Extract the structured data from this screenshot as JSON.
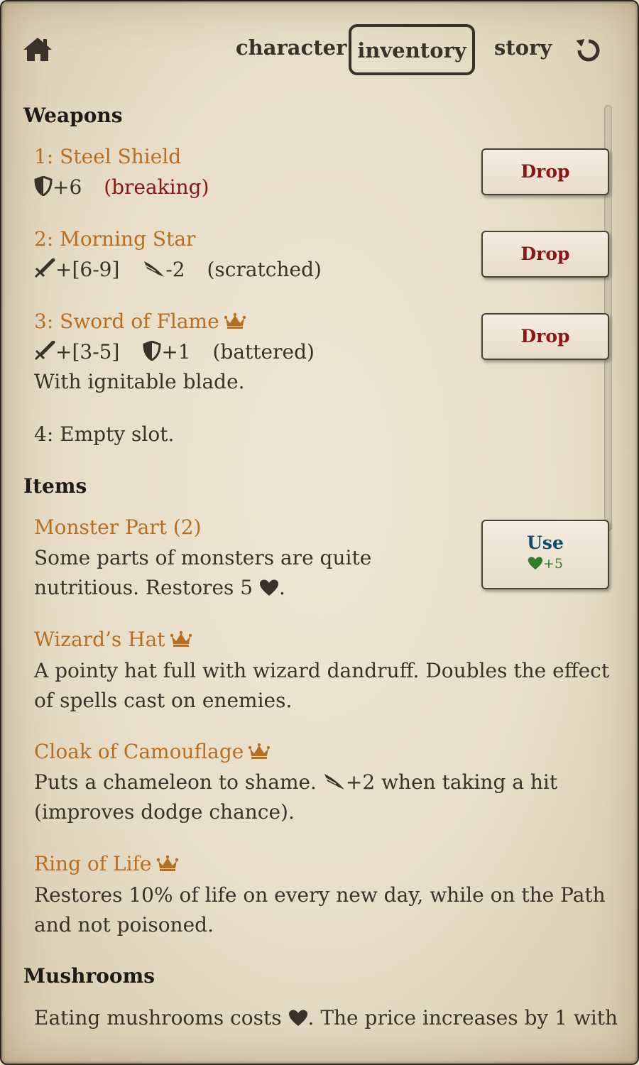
{
  "nav": {
    "tabs": [
      "character",
      "inventory",
      "story"
    ],
    "active_tab": "inventory",
    "home_icon": "home-icon",
    "reset_icon": "restart-icon"
  },
  "weapons": {
    "title": "Weapons",
    "items": [
      {
        "name": "1: Steel Shield",
        "stats": [
          {
            "icon": "shield-icon",
            "value": "+6"
          }
        ],
        "condition": "(breaking)",
        "button": "Drop"
      },
      {
        "name": "2: Morning Star",
        "stats": [
          {
            "icon": "sword-icon",
            "value": "+[6-9]"
          },
          {
            "icon": "wing-icon",
            "value": "-2"
          }
        ],
        "condition": "(scratched)",
        "button": "Drop"
      },
      {
        "name": "3: Sword of Flame",
        "legendary": true,
        "stats": [
          {
            "icon": "sword-icon",
            "value": "+[3-5]"
          },
          {
            "icon": "shield-icon",
            "value": "+1"
          }
        ],
        "condition": "(battered)",
        "description": "With ignitable blade.",
        "button": "Drop"
      },
      {
        "name": "4: Empty slot."
      }
    ]
  },
  "items": {
    "title": "Items",
    "list": [
      {
        "name": "Monster Part (2)",
        "desc_before": "Some parts of monsters are quite",
        "desc_line2": "nutritious. Restores 5",
        "desc_after": ".",
        "button": "Use",
        "button_effect": "+5"
      },
      {
        "name": "Wizard’s Hat",
        "legendary": true,
        "description": "A pointy hat full with wizard dandruff. Doubles the effect of spells cast on enemies."
      },
      {
        "name": "Cloak of Camouflage",
        "legendary": true,
        "desc_before": "Puts a chameleon to shame.",
        "desc_stat": "+2",
        "desc_after": "when taking a hit",
        "desc_line2": "(improves dodge chance)."
      },
      {
        "name": "Ring of Life",
        "legendary": true,
        "description": "Restores 10% of life on every new day, while on the Path and not poisoned."
      }
    ]
  },
  "mushrooms": {
    "title": "Mushrooms",
    "desc_before": "Eating mushrooms costs",
    "desc_after": ". The price increases by 1 with"
  },
  "colors": {
    "item_name": "#b86e1f",
    "drop_text": "#8a1616",
    "use_text": "#0f4c6e",
    "heart_green": "#2f7d2a",
    "condition_red": "#8a1616"
  }
}
